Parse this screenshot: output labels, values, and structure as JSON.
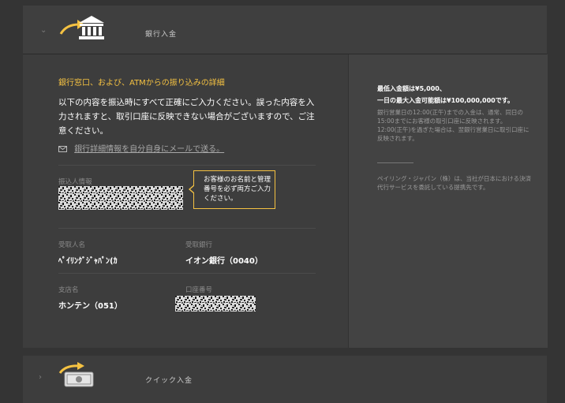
{
  "bank_panel": {
    "title": "銀行入金",
    "section_title": "銀行窓口、および、ATMからの振り込みの詳細",
    "intro": "以下の内容を振込時にすべて正確にご入力ください。誤った内容を入力されますと、取引口座に反映できない場合がございますので、ご注意ください。",
    "email_link": "銀行詳細情報を自分自身にメールで送る。",
    "transfer_info_label": "振込人情報",
    "tooltip": "お客様のお名前と管理番号を必ず両方ご入力ください。",
    "payee_name_label": "受取人名",
    "payee_name_value": "ﾍﾟｲﾘﾝｸﾞｼﾞｬﾊﾟﾝ(ｶ",
    "payee_bank_label": "受取銀行",
    "payee_bank_value": "イオン銀行（0040）",
    "branch_label": "支店名",
    "branch_value": "ホンテン（051）",
    "account_label": "口座番号"
  },
  "sidebar_info": {
    "min_amount": "最低入金額は¥5,000、",
    "max_daily": "一日の最大入金可能額は¥100,000,000です。",
    "note": "銀行営業日の12:00(正午)までの入金は、通常、同日の15:00までにお客様の取引口座に反映されます。12:00(正午)を過ぎた場合は、翌銀行営業日に取引口座に反映されます。",
    "partner_note": "ペイリング・ジャパン（株）は、当社が日本における決済代行サービスを委託している提携先です。"
  },
  "quick_panel": {
    "title": "クイック入金"
  },
  "colors": {
    "accent": "#f5c242",
    "background": "#343434",
    "panel": "#3d3d3d"
  },
  "icons": {
    "bank": "bank-building-icon",
    "money": "money-bill-icon",
    "arrow": "curved-arrow-icon",
    "envelope": "envelope-icon"
  }
}
